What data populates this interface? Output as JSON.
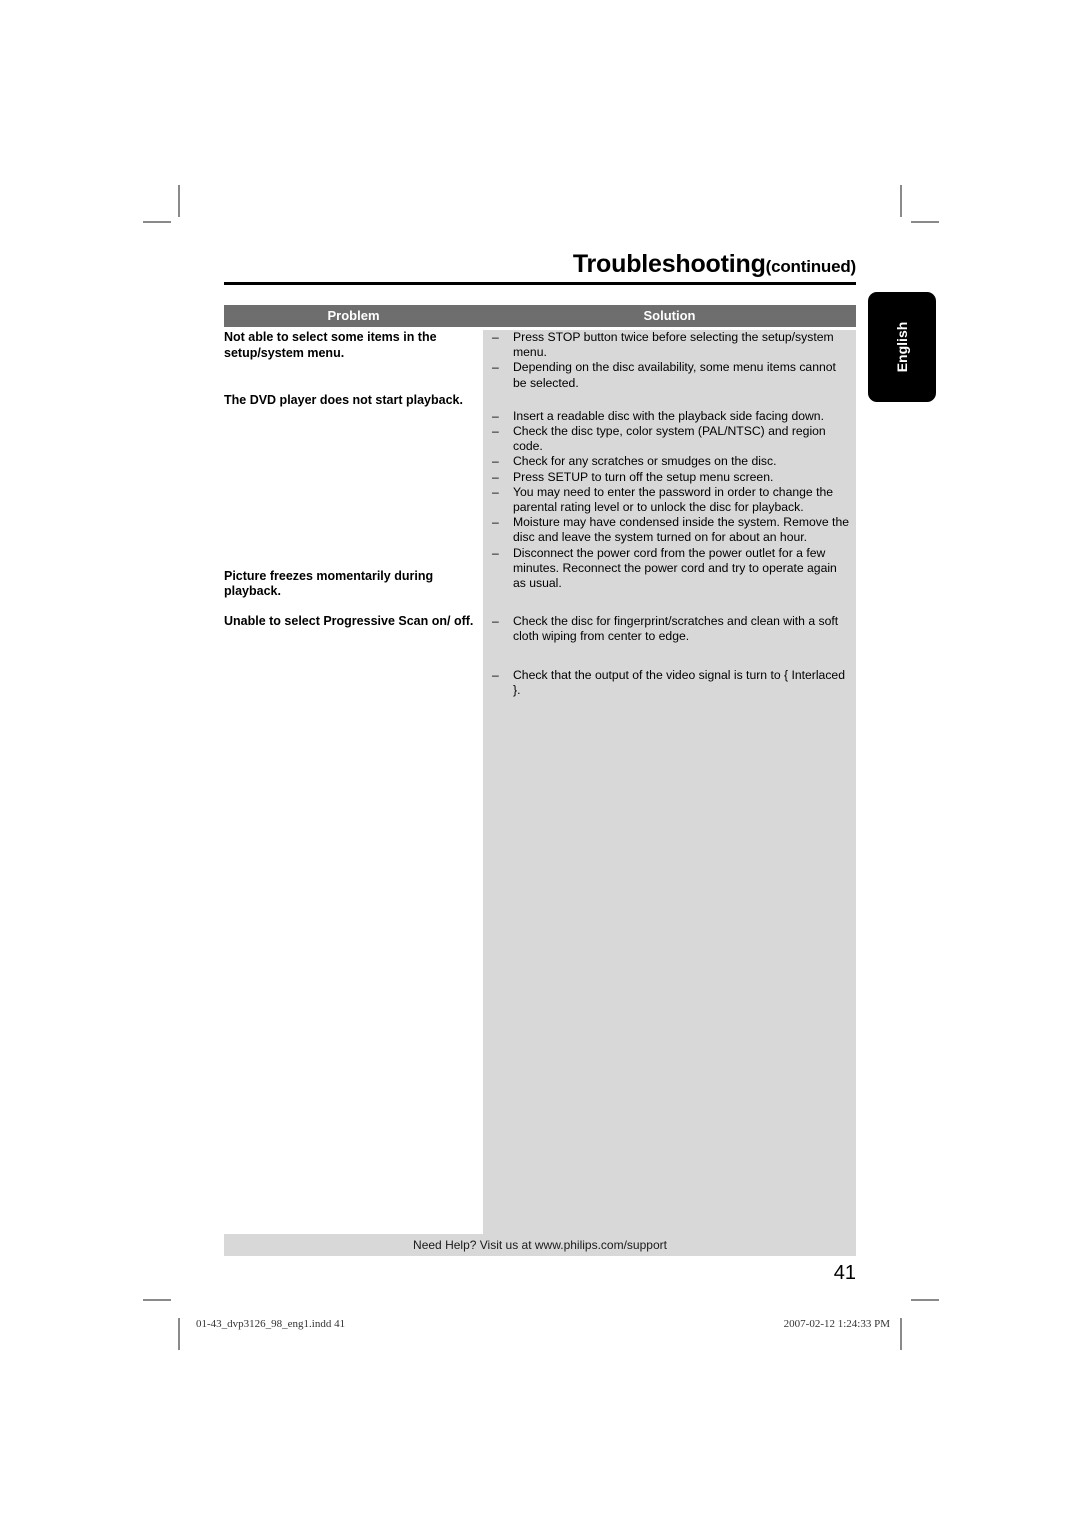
{
  "page": {
    "title_main": "Troubleshooting",
    "title_continued": "(continued)",
    "page_number": "41",
    "language_tab": "English"
  },
  "table": {
    "header": {
      "problem": "Problem",
      "solution": "Solution"
    },
    "rows": [
      {
        "problem": "Not able to select some items in the setup/system menu.",
        "solutions": [
          "Press STOP button twice before selecting the setup/system menu.",
          "Depending on the disc availability, some menu items cannot be selected."
        ]
      },
      {
        "problem": "The DVD player does not start playback.",
        "solutions": [
          "Insert a readable disc with the playback side facing down.",
          "Check the disc type, color system (PAL/NTSC) and region code.",
          "Check for any scratches or smudges on the disc.",
          "Press SETUP to turn off the setup menu screen.",
          "You may need to enter the password in order to change the parental rating level or to unlock the disc for playback.",
          "Moisture may have condensed inside the system. Remove the disc and leave the system turned on for about an hour.",
          "Disconnect the power cord from the power outlet for a few minutes. Reconnect the power cord and try to operate again as usual."
        ]
      },
      {
        "problem": "Picture freezes momentarily during playback.",
        "solutions": [
          "Check the disc for fingerprint/scratches and clean with a soft cloth wiping from center to edge."
        ]
      },
      {
        "problem": "Unable to select Progressive Scan on/ off.",
        "solutions": [
          "Check that the output of the video signal is turn to { Interlaced }."
        ]
      }
    ],
    "bullet_dash": "–"
  },
  "footer": {
    "support_text": "Need Help? Visit us at www.philips.com/support"
  },
  "production_slug": {
    "file": "01-43_dvp3126_98_eng1.indd   41",
    "timestamp": "2007-02-12   1:24:33 PM"
  }
}
